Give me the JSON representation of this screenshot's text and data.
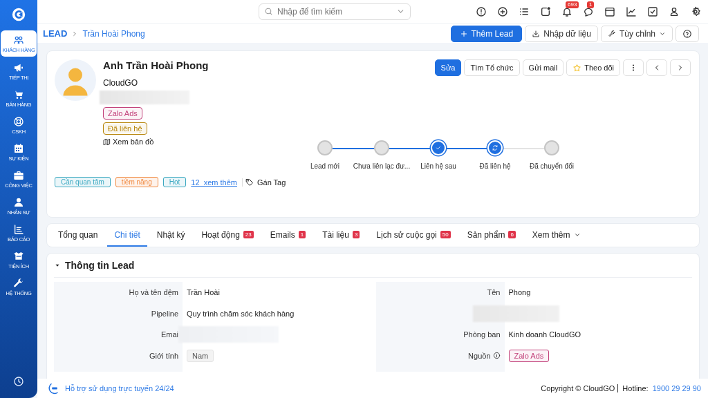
{
  "sidebar": {
    "items": [
      {
        "label": "KHÁCH HÀNG",
        "selected": true
      },
      {
        "label": "TIẾP THỊ",
        "selected": false
      },
      {
        "label": "BÁN HÀNG",
        "selected": false
      },
      {
        "label": "CSKH",
        "selected": false
      },
      {
        "label": "SỰ KIỆN",
        "selected": false
      },
      {
        "label": "CÔNG VIỆC",
        "selected": false
      },
      {
        "label": "NHÂN SỰ",
        "selected": false
      },
      {
        "label": "BÁO CÁO",
        "selected": false
      },
      {
        "label": "TIỆN ÍCH",
        "selected": false
      },
      {
        "label": "HỆ THỐNG",
        "selected": false
      }
    ]
  },
  "topbar": {
    "search": {
      "placeholder": "Nhập để tìm kiếm"
    },
    "notification_badge": "693",
    "message_badge": "1"
  },
  "breadcrumb": [
    "LEAD",
    "Trần Hoài Phong"
  ],
  "page_actions": [
    {
      "label": "Thêm Lead",
      "kind": "primary"
    },
    {
      "label": "Nhập dữ liệu",
      "kind": "import"
    },
    {
      "label": "Tùy chỉnh",
      "kind": "menu"
    },
    {
      "kind": "help"
    }
  ],
  "lead": {
    "name": "Anh Trần Hoài Phong",
    "company": "CloudGO",
    "badges": [
      {
        "label": "Zalo Ads",
        "color": "#c2417a"
      },
      {
        "label": "Đã liên hệ",
        "color": "#b8860b"
      }
    ],
    "map_link": "Xem bản đồ",
    "actions": [
      {
        "label": "Sửa",
        "kind": "primary"
      },
      {
        "label": "Tìm Tổ chức",
        "kind": "default"
      },
      {
        "label": "Gửi mail",
        "kind": "default"
      },
      {
        "label": "Theo dõi",
        "kind": "follow"
      }
    ],
    "stages": [
      {
        "label": "Lead mới",
        "kind": "step"
      },
      {
        "label": "Chưa liên lạc đư...",
        "kind": "step",
        "reached": true
      },
      {
        "label": "Liên hệ sau",
        "kind": "checked",
        "reached": true
      },
      {
        "label": "Đã liên hệ",
        "kind": "current",
        "reached": true
      },
      {
        "label": "Đã chuyển đổi",
        "kind": "step",
        "reached": false
      }
    ],
    "tags": [
      {
        "label": "Cần quan tâm",
        "color": "#3aa8c1"
      },
      {
        "label": "tiềm năng",
        "color": "#f0883e"
      },
      {
        "label": "Hot",
        "color": "#3aa8c1"
      }
    ],
    "more_tags": "12  xem thêm",
    "assign_tag": "Gán Tag"
  },
  "tabs": [
    {
      "label": "Tổng quan",
      "selected": false
    },
    {
      "label": "Chi tiết",
      "selected": true
    },
    {
      "label": "Nhật ký",
      "selected": false
    },
    {
      "label": "Hoạt động",
      "count": "23",
      "selected": false
    },
    {
      "label": "Emails",
      "count": "1",
      "selected": false
    },
    {
      "label": "Tài liệu",
      "count": "3",
      "selected": false
    },
    {
      "label": "Lịch sử cuộc gọi",
      "count": "50",
      "selected": false
    },
    {
      "label": "Sản phẩm",
      "count": "6",
      "selected": false
    }
  ],
  "more_tabs": "Xem thêm",
  "section": {
    "title": "Thông tin Lead",
    "expanded": true,
    "columns": [
      [
        {
          "label": "Họ và tên đệm",
          "value": "Trần Hoài",
          "kind": "text"
        },
        {
          "label": "Pipeline",
          "value": "Quy trình chăm sóc khách hàng",
          "kind": "text"
        },
        {
          "label": "Emai",
          "kind": "hidden"
        },
        {
          "label": "Giới tính",
          "value": "Nam",
          "kind": "chip"
        }
      ],
      [
        {
          "label": "Tên",
          "value": "Phong",
          "kind": "text"
        },
        {
          "kind": "hidden_row"
        },
        {
          "label": "Phòng ban",
          "value": "Kinh doanh CloudGO",
          "kind": "text"
        },
        {
          "label": "Nguồn",
          "value": "Zalo Ads",
          "kind": "tag",
          "info": true,
          "color": "#c2417a"
        }
      ]
    ]
  },
  "footer": {
    "support": "Hỗ trợ sử dụng trực tuyến 24/24",
    "copyright": "Copyright © CloudGO",
    "hotline_label": "Hotline:",
    "hotline": "1900 29 29 90"
  }
}
